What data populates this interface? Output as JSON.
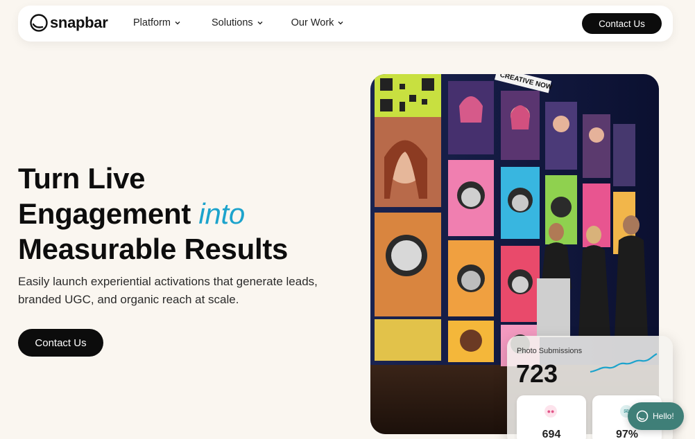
{
  "nav": {
    "logo": "snapbar",
    "links": [
      "Platform",
      "Solutions",
      "Our Work"
    ],
    "cta": "Contact Us"
  },
  "hero": {
    "title_line1": "Turn Live",
    "title_line2_start": "Engagement ",
    "title_line2_accent": "into",
    "title_line3": "Measurable Results",
    "subtitle": "Easily launch experiential activations that generate leads, branded UGC, and organic reach at scale.",
    "cta": "Contact Us",
    "image_banner": "CREATIVE NOW"
  },
  "stats": {
    "label": "Photo Submissions",
    "value": "723",
    "mini": [
      {
        "icon": "people-icon",
        "value": "694"
      },
      {
        "icon": "mail-icon",
        "value": "97%"
      }
    ]
  },
  "chat": {
    "label": "Hello!"
  },
  "colors": {
    "accent": "#1ca3cc",
    "dark": "#0c0c0c",
    "background": "#faf6f0",
    "chat": "#3f7f78"
  }
}
